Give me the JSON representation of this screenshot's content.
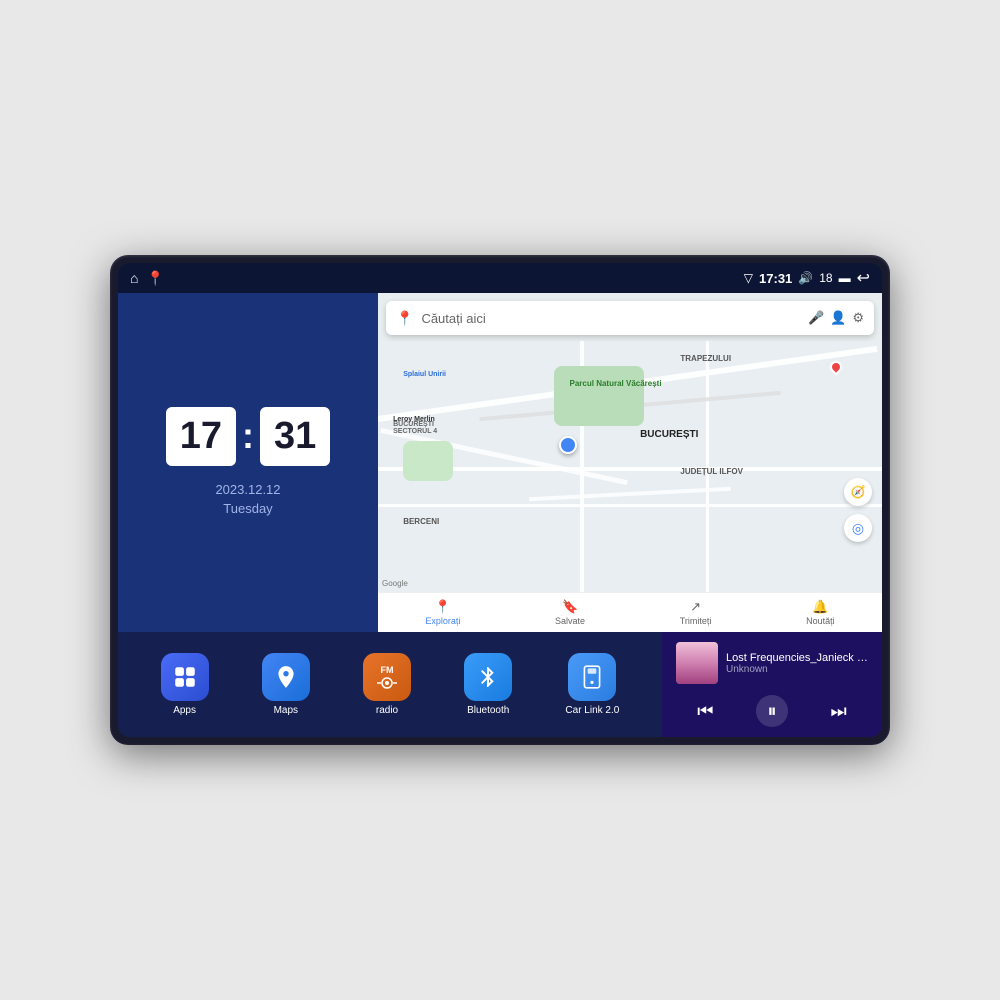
{
  "device": {
    "status_bar": {
      "left_icons": [
        "home",
        "maps"
      ],
      "time": "17:31",
      "volume_icon": "🔊",
      "battery_level": "18",
      "battery_icon": "🔋",
      "back_icon": "↩"
    },
    "clock": {
      "hour": "17",
      "minute": "31",
      "date": "2023.12.12",
      "day": "Tuesday"
    },
    "map": {
      "search_placeholder": "Căutați aici",
      "nav_items": [
        {
          "label": "Explorați",
          "icon": "📍",
          "active": true
        },
        {
          "label": "Salvate",
          "icon": "🔖",
          "active": false
        },
        {
          "label": "Trimiteți",
          "icon": "↗",
          "active": false
        },
        {
          "label": "Noutăți",
          "icon": "🔔",
          "active": false
        }
      ],
      "labels": [
        "Parcul Natural Văcărești",
        "BUCUREȘTI",
        "JUDEȚUL ILFOV",
        "TRAPEZULUI",
        "BERCENI",
        "Leroy Merlin",
        "Splaiul Unirii"
      ]
    },
    "apps": [
      {
        "id": "apps",
        "label": "Apps",
        "icon": "⊞",
        "class": "icon-apps"
      },
      {
        "id": "maps",
        "label": "Maps",
        "icon": "📍",
        "class": "icon-maps"
      },
      {
        "id": "radio",
        "label": "radio",
        "icon": "📻",
        "class": "icon-radio"
      },
      {
        "id": "bluetooth",
        "label": "Bluetooth",
        "icon": "⬡",
        "class": "icon-bluetooth"
      },
      {
        "id": "carlink",
        "label": "Car Link 2.0",
        "icon": "📱",
        "class": "icon-carlink"
      }
    ],
    "music": {
      "title": "Lost Frequencies_Janieck Devy-...",
      "artist": "Unknown",
      "prev_label": "⏮",
      "play_label": "⏸",
      "next_label": "⏭"
    }
  }
}
